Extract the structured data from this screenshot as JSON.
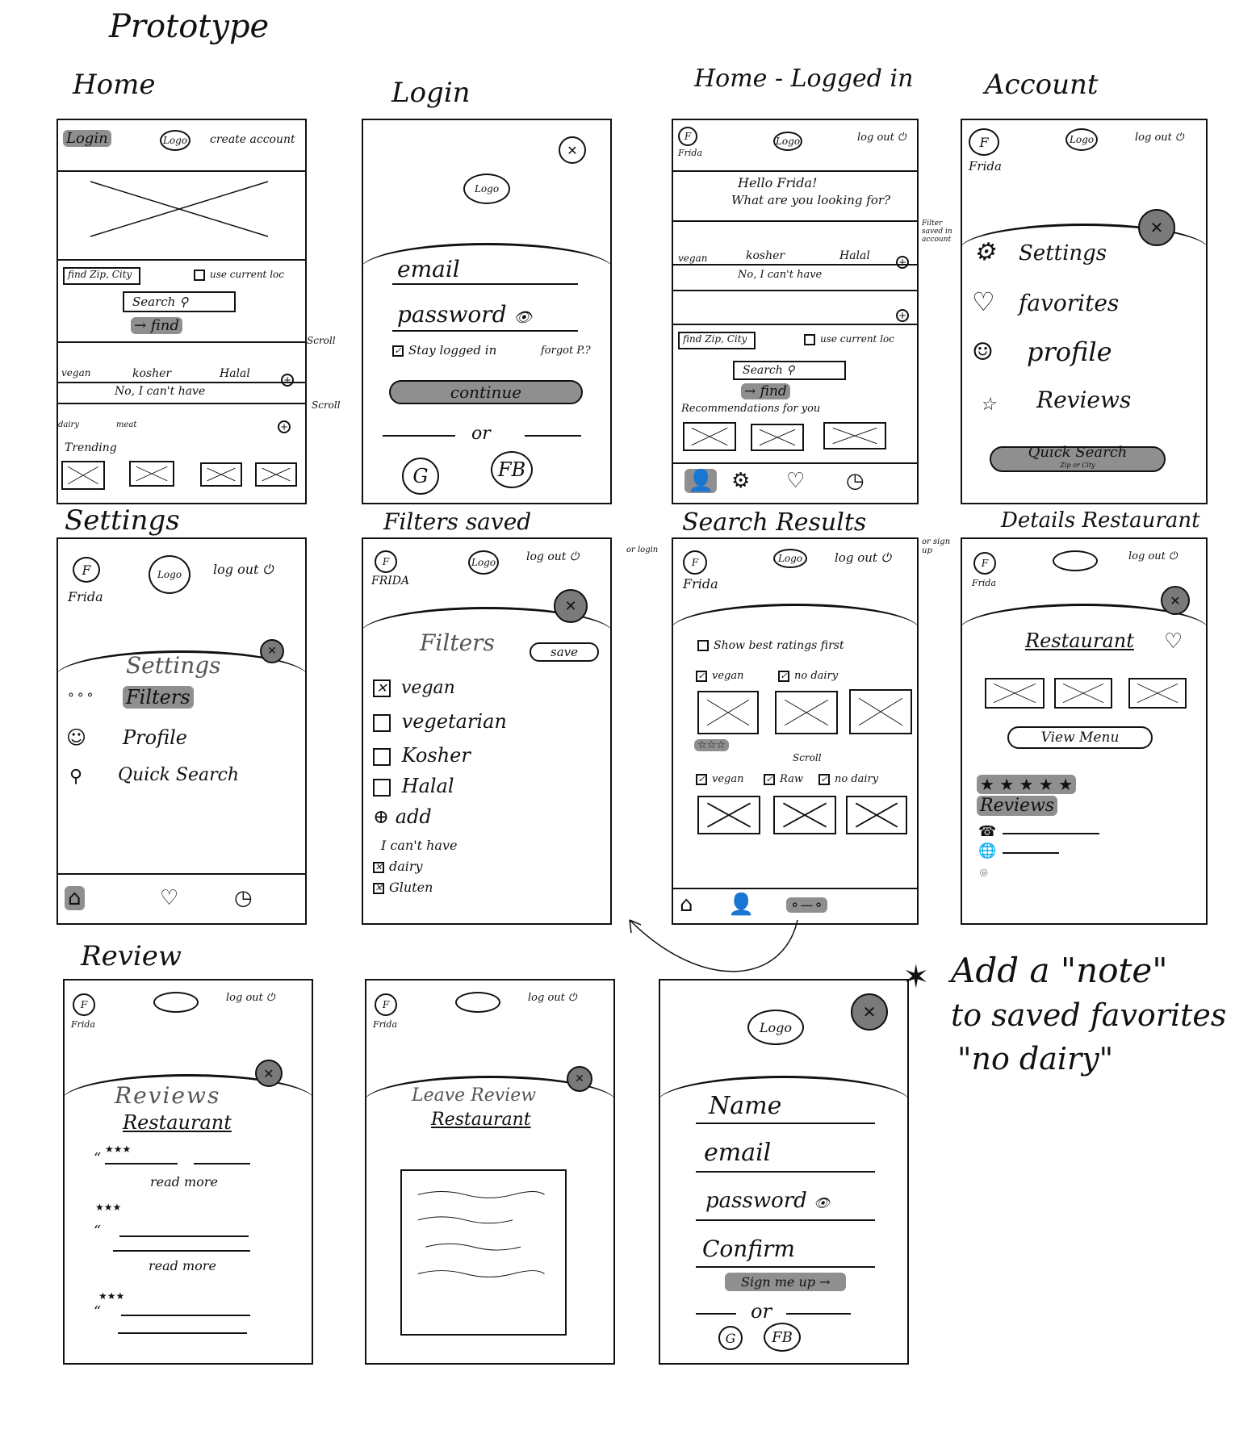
{
  "page_title": "Prototype",
  "titles": {
    "home": "Home",
    "login": "Login",
    "home_logged_in": "Home - Logged in",
    "account": "Account",
    "settings": "Settings",
    "filters_saved": "Filters saved",
    "search_results": "Search Results",
    "details_restaurant": "Details Restaurant",
    "review": "Review"
  },
  "home": {
    "login": "Login",
    "logo": "Logo",
    "create_account": "create account",
    "find_input": "find Zip, City",
    "use_current": "use current loc",
    "search": "Search",
    "find": "→ find",
    "diets": [
      "vegan",
      "kosher",
      "Halal"
    ],
    "cant_have": "No, I can't have",
    "cant_items": [
      "dairy",
      "meat"
    ],
    "scroll": "Scroll",
    "trending": "Trending"
  },
  "login": {
    "email": "email",
    "password": "password",
    "stay_logged": "Stay logged in",
    "forgot": "forgot P.?",
    "continue": "continue",
    "or": "or",
    "google": "G",
    "facebook": "FB"
  },
  "home_logged_in": {
    "avatar": "F",
    "user": "Frida",
    "logout": "log out",
    "greeting1": "Hello Frida!",
    "greeting2": "What are you looking for?",
    "diets": [
      "vegan",
      "kosher",
      "Halal"
    ],
    "cant_have": "No, I can't have",
    "side_note": "Filter saved in account",
    "find_input": "find Zip, City",
    "use_current": "use current loc",
    "search": "Search",
    "find": "→ find",
    "recommendations": "Recommendations for you"
  },
  "account": {
    "avatar": "F",
    "user": "Frida",
    "logout": "log out",
    "items": [
      "Settings",
      "favorites",
      "profile",
      "Reviews"
    ],
    "quick_search": "Quick Search",
    "quick_sub": "Zip or City"
  },
  "settings": {
    "avatar": "F",
    "user": "Frida",
    "logout": "log out",
    "heading": "Settings",
    "items": [
      "Filters",
      "Profile",
      "Quick Search"
    ]
  },
  "filters_saved": {
    "avatar": "F",
    "user": "FRIDA",
    "logout": "log out",
    "heading": "Filters",
    "save": "save",
    "items": [
      {
        "label": "vegan",
        "checked": true
      },
      {
        "label": "vegetarian",
        "checked": false
      },
      {
        "label": "Kosher",
        "checked": false
      },
      {
        "label": "Halal",
        "checked": false
      }
    ],
    "add": "add",
    "cant_have": "I can't have",
    "cant_items": [
      "dairy",
      "Gluten"
    ]
  },
  "search_results": {
    "avatar": "F",
    "user": "Frida",
    "logout": "log out",
    "side_left": "or login",
    "side_right": "or sign up",
    "show_best": "Show best ratings first",
    "tags1": [
      "vegan",
      "no dairy"
    ],
    "tags2": [
      "vegan",
      "Raw",
      "no dairy"
    ],
    "scroll": "Scroll"
  },
  "details": {
    "avatar": "F",
    "user": "Frida",
    "logout": "log out",
    "restaurant": "Restaurant",
    "view_menu": "View Menu",
    "stars": "★ ★ ★ ★ ★",
    "reviews": "Reviews"
  },
  "review1": {
    "avatar": "F",
    "user": "Frida",
    "logout": "log out",
    "heading": "Reviews",
    "restaurant": "Restaurant",
    "read_more": "read more"
  },
  "review2": {
    "avatar": "F",
    "user": "Frida",
    "logout": "log out",
    "heading": "Leave Review",
    "restaurant": "Restaurant"
  },
  "signup": {
    "logo": "Logo",
    "name": "Name",
    "email": "email",
    "password": "password",
    "confirm": "Confirm",
    "sign_up": "Sign me up →",
    "or": "or",
    "google": "G",
    "facebook": "FB"
  },
  "note": {
    "line1": "Add a \"note\"",
    "line2": "to saved favorites",
    "line3": "\"no dairy\""
  }
}
